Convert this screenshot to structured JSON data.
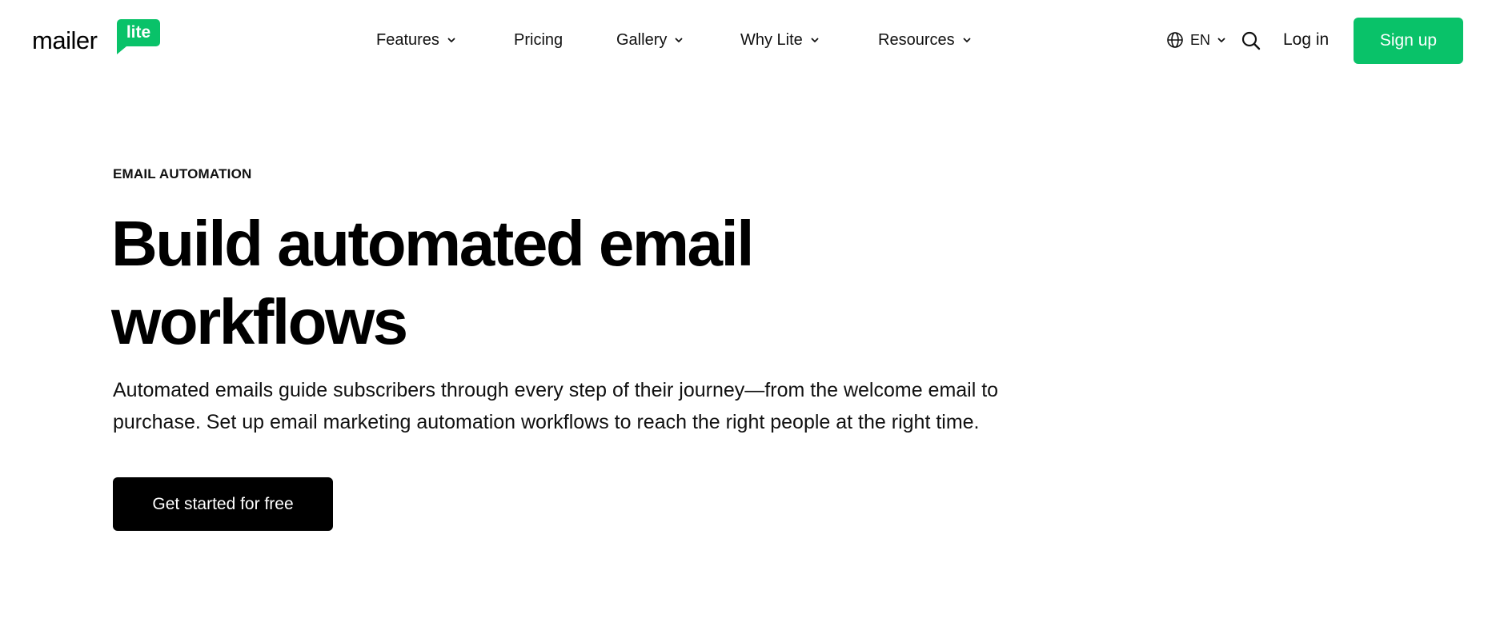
{
  "header": {
    "logo": {
      "word": "mailer",
      "badge": "lite"
    },
    "nav": [
      {
        "label": "Features",
        "has_dropdown": true
      },
      {
        "label": "Pricing",
        "has_dropdown": false
      },
      {
        "label": "Gallery",
        "has_dropdown": true
      },
      {
        "label": "Why Lite",
        "has_dropdown": true
      },
      {
        "label": "Resources",
        "has_dropdown": true
      }
    ],
    "language": {
      "label": "EN",
      "icon": "globe-icon"
    },
    "search_icon": "search-icon",
    "login_label": "Log in",
    "signup_label": "Sign up"
  },
  "hero": {
    "eyebrow": "EMAIL AUTOMATION",
    "title_line1": "Build automated email",
    "title_line2": "workflows",
    "subtitle_line1": "Automated emails guide subscribers through every step of their journey—from the welcome email to",
    "subtitle_line2": "purchase. Set up email marketing automation workflows to reach the right people at the right time.",
    "cta_label": "Get started for free"
  },
  "colors": {
    "brand_green": "#09c269",
    "text": "#000000",
    "cta_bg": "#000000",
    "background": "#ffffff"
  }
}
